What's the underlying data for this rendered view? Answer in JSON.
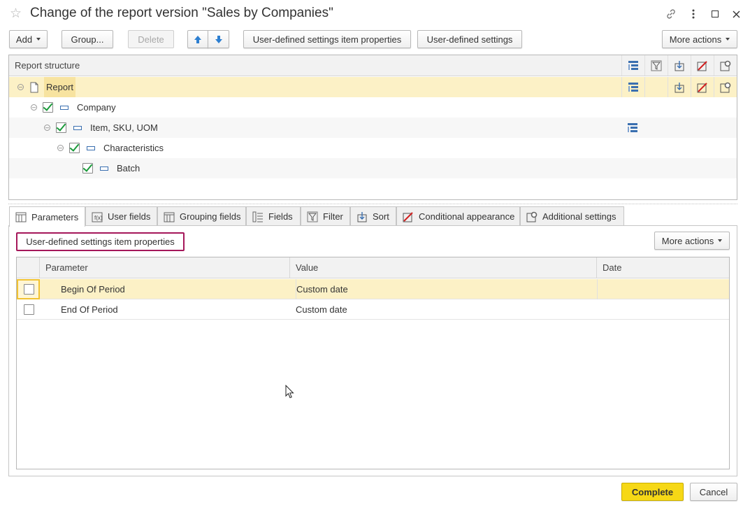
{
  "window": {
    "title": "Change of the report version \"Sales by Companies\""
  },
  "toolbar": {
    "add_label": "Add",
    "group_label": "Group...",
    "delete_label": "Delete",
    "user_defined_item_props_label": "User-defined settings item properties",
    "user_defined_settings_label": "User-defined settings",
    "more_actions_label": "More actions"
  },
  "structure": {
    "header": "Report structure",
    "rows": [
      {
        "label": "Report"
      },
      {
        "label": "Company"
      },
      {
        "label": "Item, SKU, UOM"
      },
      {
        "label": "Characteristics"
      },
      {
        "label": "Batch"
      }
    ]
  },
  "tabs": [
    {
      "label": "Parameters"
    },
    {
      "label": "User fields"
    },
    {
      "label": "Grouping fields"
    },
    {
      "label": "Fields"
    },
    {
      "label": "Filter"
    },
    {
      "label": "Sort"
    },
    {
      "label": "Conditional appearance"
    },
    {
      "label": "Additional settings"
    }
  ],
  "params": {
    "item_props_label": "User-defined settings item properties",
    "more_actions_label": "More actions",
    "columns": {
      "parameter": "Parameter",
      "value": "Value",
      "date": "Date"
    },
    "rows": [
      {
        "parameter": "Begin Of Period",
        "value": "Custom date",
        "date": "",
        "checked": false
      },
      {
        "parameter": "End Of Period",
        "value": "Custom date",
        "date": "",
        "checked": false
      }
    ]
  },
  "footer": {
    "complete_label": "Complete",
    "cancel_label": "Cancel"
  },
  "colors": {
    "selection": "#fcf1c6",
    "complete_button": "#f6d816",
    "highlight_border": "#a5175a",
    "check": "#1a9a3a",
    "icon_blue": "#3a6fb0"
  }
}
